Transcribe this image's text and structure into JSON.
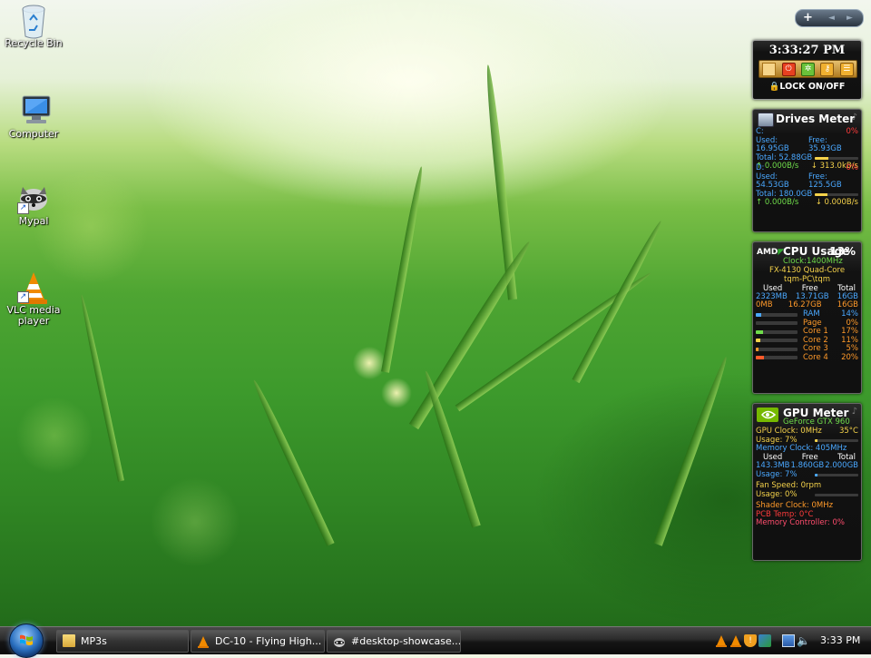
{
  "desktop": {
    "icons": [
      {
        "label": "Recycle Bin",
        "icon": "recycle-bin-icon"
      },
      {
        "label": "Computer",
        "icon": "computer-icon"
      },
      {
        "label": "Mypal",
        "icon": "mypal-icon"
      },
      {
        "label_line1": "VLC media",
        "label_line2": "player",
        "icon": "vlc-icon"
      }
    ]
  },
  "sidebar_controls": {
    "add": "+",
    "prev": "◄",
    "next": "►"
  },
  "clock_gadget": {
    "time": "3:33:27 PM",
    "lock_label": "LOCK ON/OFF",
    "buttons": [
      "sleep-button",
      "power-button",
      "settings-button",
      "key-button",
      "lock-screen-button"
    ]
  },
  "drives_meter": {
    "title": "Drives Meter",
    "drives": [
      {
        "letter": "C:",
        "percent": "0%",
        "used": "Used: 16.95GB",
        "free": "Free: 35.93GB",
        "total": "Total: 52.88GB",
        "fill": 0.32,
        "up": "0.000B/s",
        "down": "313.0kB/s"
      },
      {
        "letter": "D:",
        "percent": "0%",
        "used": "Used: 54.53GB",
        "free": "Free: 125.5GB",
        "total": "Total: 180.0GB",
        "fill": 0.3,
        "up": "0.000B/s",
        "down": "0.000B/s"
      }
    ]
  },
  "cpu_usage": {
    "title": "CPU Usage",
    "percent": "13%",
    "clock": "Clock:1400MHz",
    "model": "FX-4130 Quad-Core",
    "host": "tqm-PC\\tqm",
    "headers": [
      "Used",
      "Free",
      "Total"
    ],
    "ram_row": [
      "2323MB",
      "13.71GB",
      "16GB"
    ],
    "page_row": [
      "0MB",
      "16.27GB",
      "16GB"
    ],
    "meters": [
      {
        "label": "RAM",
        "value": "14%",
        "fill": 0.14,
        "color": "#4aa8ff"
      },
      {
        "label": "Page",
        "value": "0%",
        "fill": 0.0,
        "color": "#ff9a2a"
      },
      {
        "label": "Core 1",
        "value": "17%",
        "fill": 0.17,
        "color": "#6fdc4a"
      },
      {
        "label": "Core 2",
        "value": "11%",
        "fill": 0.11,
        "color": "#f5d24a"
      },
      {
        "label": "Core 3",
        "value": "5%",
        "fill": 0.05,
        "color": "#ff9a2a"
      },
      {
        "label": "Core 4",
        "value": "20%",
        "fill": 0.2,
        "color": "#ff5a2a"
      }
    ]
  },
  "gpu_meter": {
    "title": "GPU Meter",
    "model": "GeForce GTX 960",
    "gpu_clock": "GPU Clock: 0MHz",
    "temp": "35°C",
    "usage1": "Usage: 7%",
    "usage1_fill": 0.07,
    "memory_clock": "Memory Clock: 405MHz",
    "headers": [
      "Used",
      "Free",
      "Total"
    ],
    "mem_row": [
      "143.3MB",
      "1.860GB",
      "2.000GB"
    ],
    "usage2": "Usage: 7%",
    "usage2_fill": 0.07,
    "fan_speed": "Fan Speed: 0rpm",
    "usage3": "Usage: 0%",
    "usage3_fill": 0.0,
    "shader_clock": "Shader Clock: 0MHz",
    "pcb_temp": "PCB Temp: 0°C",
    "memory_controller": "Memory Controller: 0%"
  },
  "taskbar": {
    "buttons": [
      {
        "label": "MP3s",
        "icon": "folder-icon"
      },
      {
        "label": "DC-10 - Flying High...",
        "icon": "vlc-icon"
      },
      {
        "label": "#desktop-showcase...",
        "icon": "mypal-icon"
      }
    ],
    "clock": "3:33 PM"
  }
}
